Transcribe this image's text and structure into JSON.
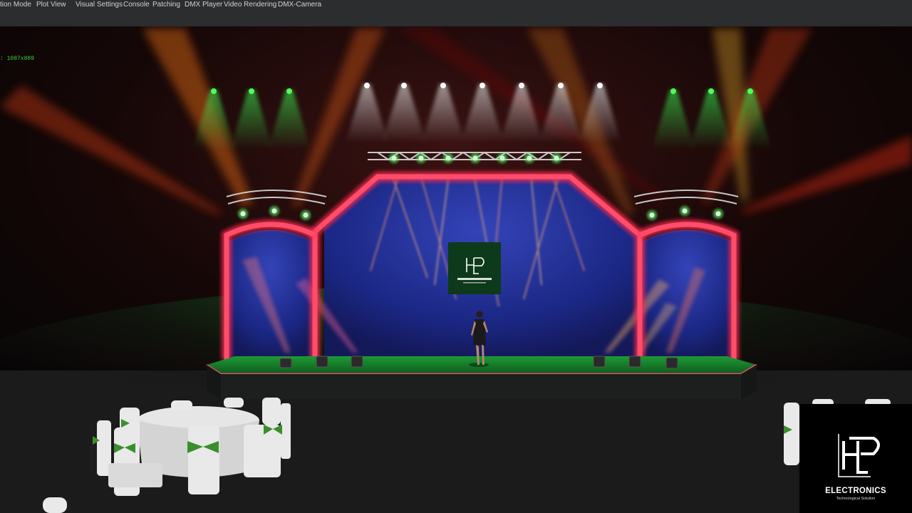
{
  "menu": {
    "items": [
      "tion Mode",
      "Plot View",
      "Visual Settings",
      "Console",
      "Patching",
      "DMX Player",
      "Video Rendering",
      "DMX-Camera"
    ]
  },
  "viewport": {
    "readout": ": 1087x889"
  },
  "overlay_logo": {
    "brand": "ELECTRONICS",
    "tagline": "Technological Solution"
  },
  "colors": {
    "menubar_bg": "#2b2d2f",
    "menu_text": "#d0d3d6",
    "readout_text": "#3cd23c",
    "stage_frame": "#ff2b4f",
    "backdrop": "#1e2f8c",
    "stage_floor": "#1fa83a"
  },
  "icons": [
    "hp-logo-icon"
  ]
}
